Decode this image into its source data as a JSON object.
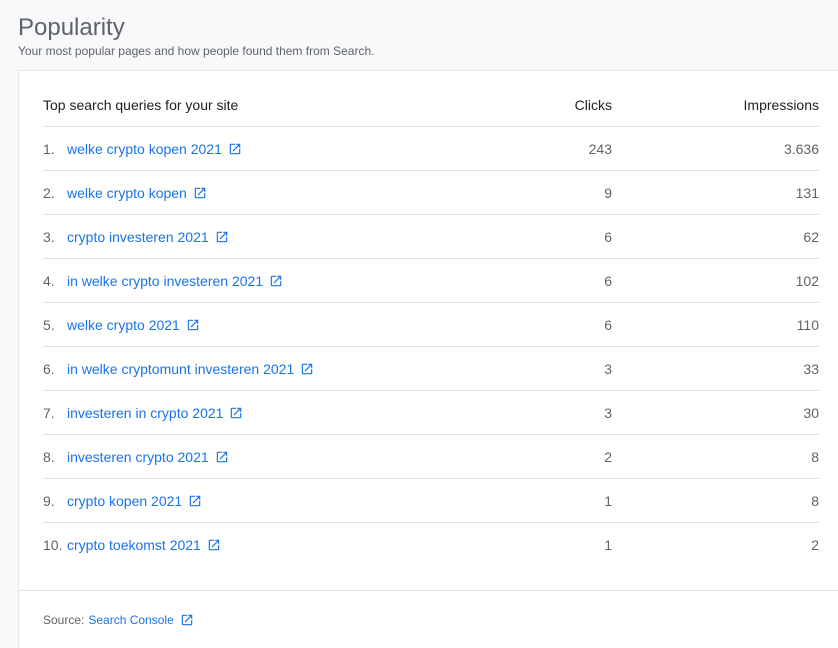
{
  "page": {
    "title": "Popularity",
    "subtitle": "Your most popular pages and how people found them from Search."
  },
  "table": {
    "header": {
      "query": "Top search queries for your site",
      "clicks": "Clicks",
      "impressions": "Impressions"
    },
    "rows": [
      {
        "rank": "1.",
        "query": "welke crypto kopen 2021",
        "clicks": "243",
        "impressions": "3.636"
      },
      {
        "rank": "2.",
        "query": "welke crypto kopen",
        "clicks": "9",
        "impressions": "131"
      },
      {
        "rank": "3.",
        "query": "crypto investeren 2021",
        "clicks": "6",
        "impressions": "62"
      },
      {
        "rank": "4.",
        "query": "in welke crypto investeren 2021",
        "clicks": "6",
        "impressions": "102"
      },
      {
        "rank": "5.",
        "query": "welke crypto 2021",
        "clicks": "6",
        "impressions": "110"
      },
      {
        "rank": "6.",
        "query": "in welke cryptomunt investeren 2021",
        "clicks": "3",
        "impressions": "33"
      },
      {
        "rank": "7.",
        "query": "investeren in crypto 2021",
        "clicks": "3",
        "impressions": "30"
      },
      {
        "rank": "8.",
        "query": "investeren crypto 2021",
        "clicks": "2",
        "impressions": "8"
      },
      {
        "rank": "9.",
        "query": "crypto kopen 2021",
        "clicks": "1",
        "impressions": "8"
      },
      {
        "rank": "10.",
        "query": "crypto toekomst 2021",
        "clicks": "1",
        "impressions": "2"
      }
    ]
  },
  "footer": {
    "source_label": "Source:",
    "source_link": "Search Console"
  },
  "icons": {
    "external_link": "open-in-new-icon"
  },
  "colors": {
    "link": "#1a73e8",
    "text": "#5f6368"
  }
}
